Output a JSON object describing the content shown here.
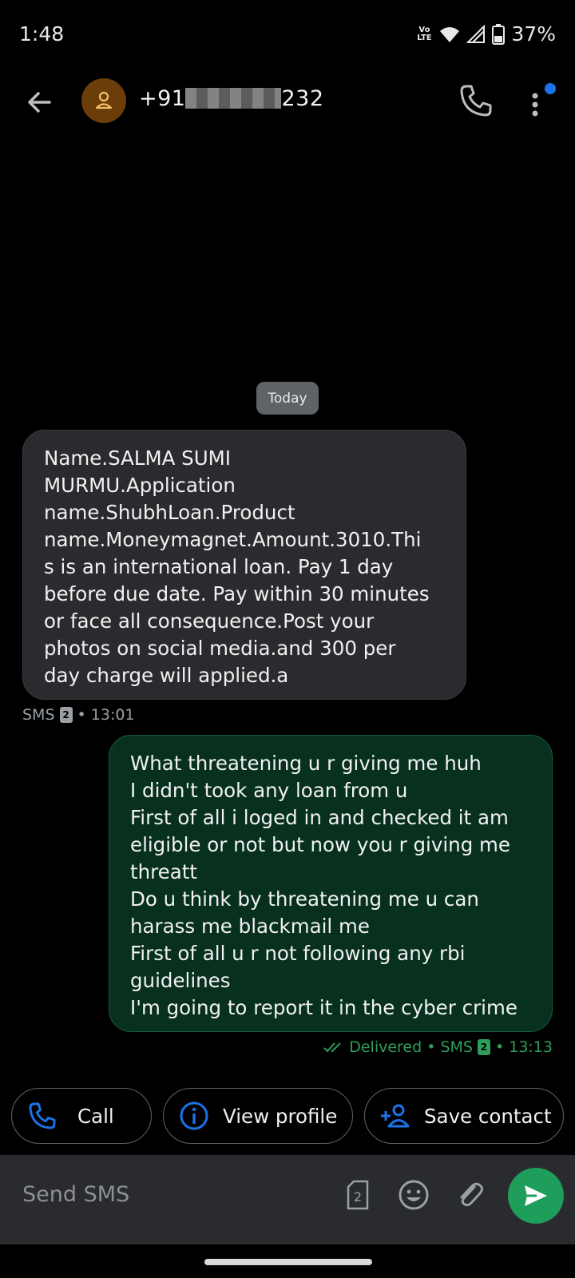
{
  "status_bar": {
    "time": "1:48",
    "network_label": "Vo\nLTE",
    "battery_percent": "37%"
  },
  "header": {
    "number_prefix": "+91",
    "number_suffix": "232",
    "icons": [
      "back-arrow-icon",
      "person-icon",
      "phone-icon",
      "more-vert-icon"
    ]
  },
  "conversation": {
    "date_chip": "Today",
    "messages": [
      {
        "direction": "incoming",
        "text": "Name.SALMA SUMI\nMURMU.Application\nname.ShubhLoan.Product\nname.Moneymagnet.Amount.3010.Thi\ns is an international loan. Pay 1 day\nbefore due date. Pay within 30 minutes\nor face all consequence.Post your\nphotos on social media.and 300 per\nday charge will applied.a",
        "meta_type": "SMS",
        "sim": "2",
        "time": "• 13:01"
      },
      {
        "direction": "outgoing",
        "text": "What threatening u r giving me huh\nI didn't took any loan from u\nFirst of all i loged in and checked it am\neligible or not but now you r giving me\nthreatt\nDo u think by threatening me u can\nharass me blackmail me\nFirst of all u r not following any rbi\nguidelines\nI'm going to report it in the cyber crime",
        "status": "Delivered • SMS",
        "sim": "2",
        "time": "• 13:13"
      }
    ]
  },
  "actions": {
    "call_label": "Call",
    "view_profile_label": "View profile",
    "save_contact_label": "Save contact"
  },
  "compose": {
    "placeholder": "Send SMS",
    "sim_label": "2"
  },
  "colors": {
    "incoming_bubble": "#2a2b2e",
    "outgoing_bubble": "#07301f",
    "accent_blue": "#1a73e8",
    "send_green": "#1e9e5a",
    "avatar_brown": "#6b3d09"
  }
}
